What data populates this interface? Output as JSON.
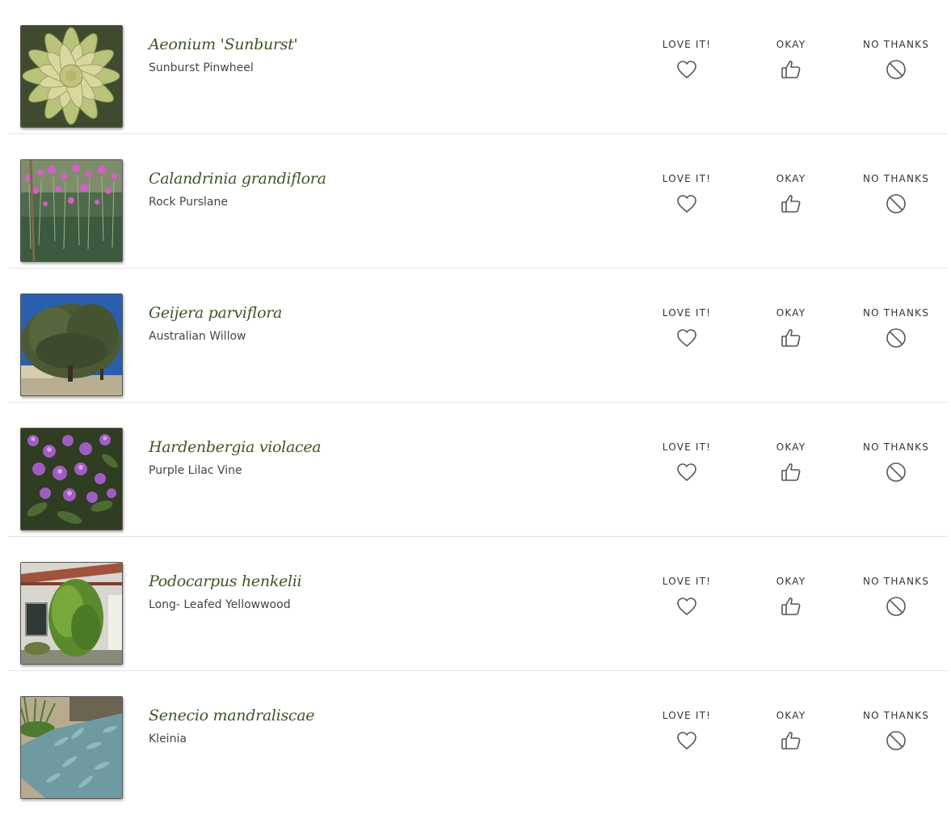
{
  "rating_labels": {
    "love": "LOVE IT!",
    "okay": "OKAY",
    "no_thanks": "NO THANKS"
  },
  "colors": {
    "scientific_name": "#3e5527",
    "common_name": "#444444",
    "icon_stroke": "#555555",
    "divider": "#e3e3e3"
  },
  "icons": {
    "love": "heart-icon",
    "okay": "thumbs-up-icon",
    "no_thanks": "prohibited-icon"
  },
  "plants": [
    {
      "scientific_name": "Aeonium 'Sunburst'",
      "common_name": "Sunburst Pinwheel"
    },
    {
      "scientific_name": "Calandrinia grandiflora",
      "common_name": "Rock Purslane"
    },
    {
      "scientific_name": "Geijera parviflora",
      "common_name": "Australian Willow"
    },
    {
      "scientific_name": "Hardenbergia violacea",
      "common_name": "Purple Lilac Vine"
    },
    {
      "scientific_name": "Podocarpus henkelii",
      "common_name": "Long- Leafed Yellowwood"
    },
    {
      "scientific_name": "Senecio mandraliscae",
      "common_name": "Kleinia"
    }
  ]
}
